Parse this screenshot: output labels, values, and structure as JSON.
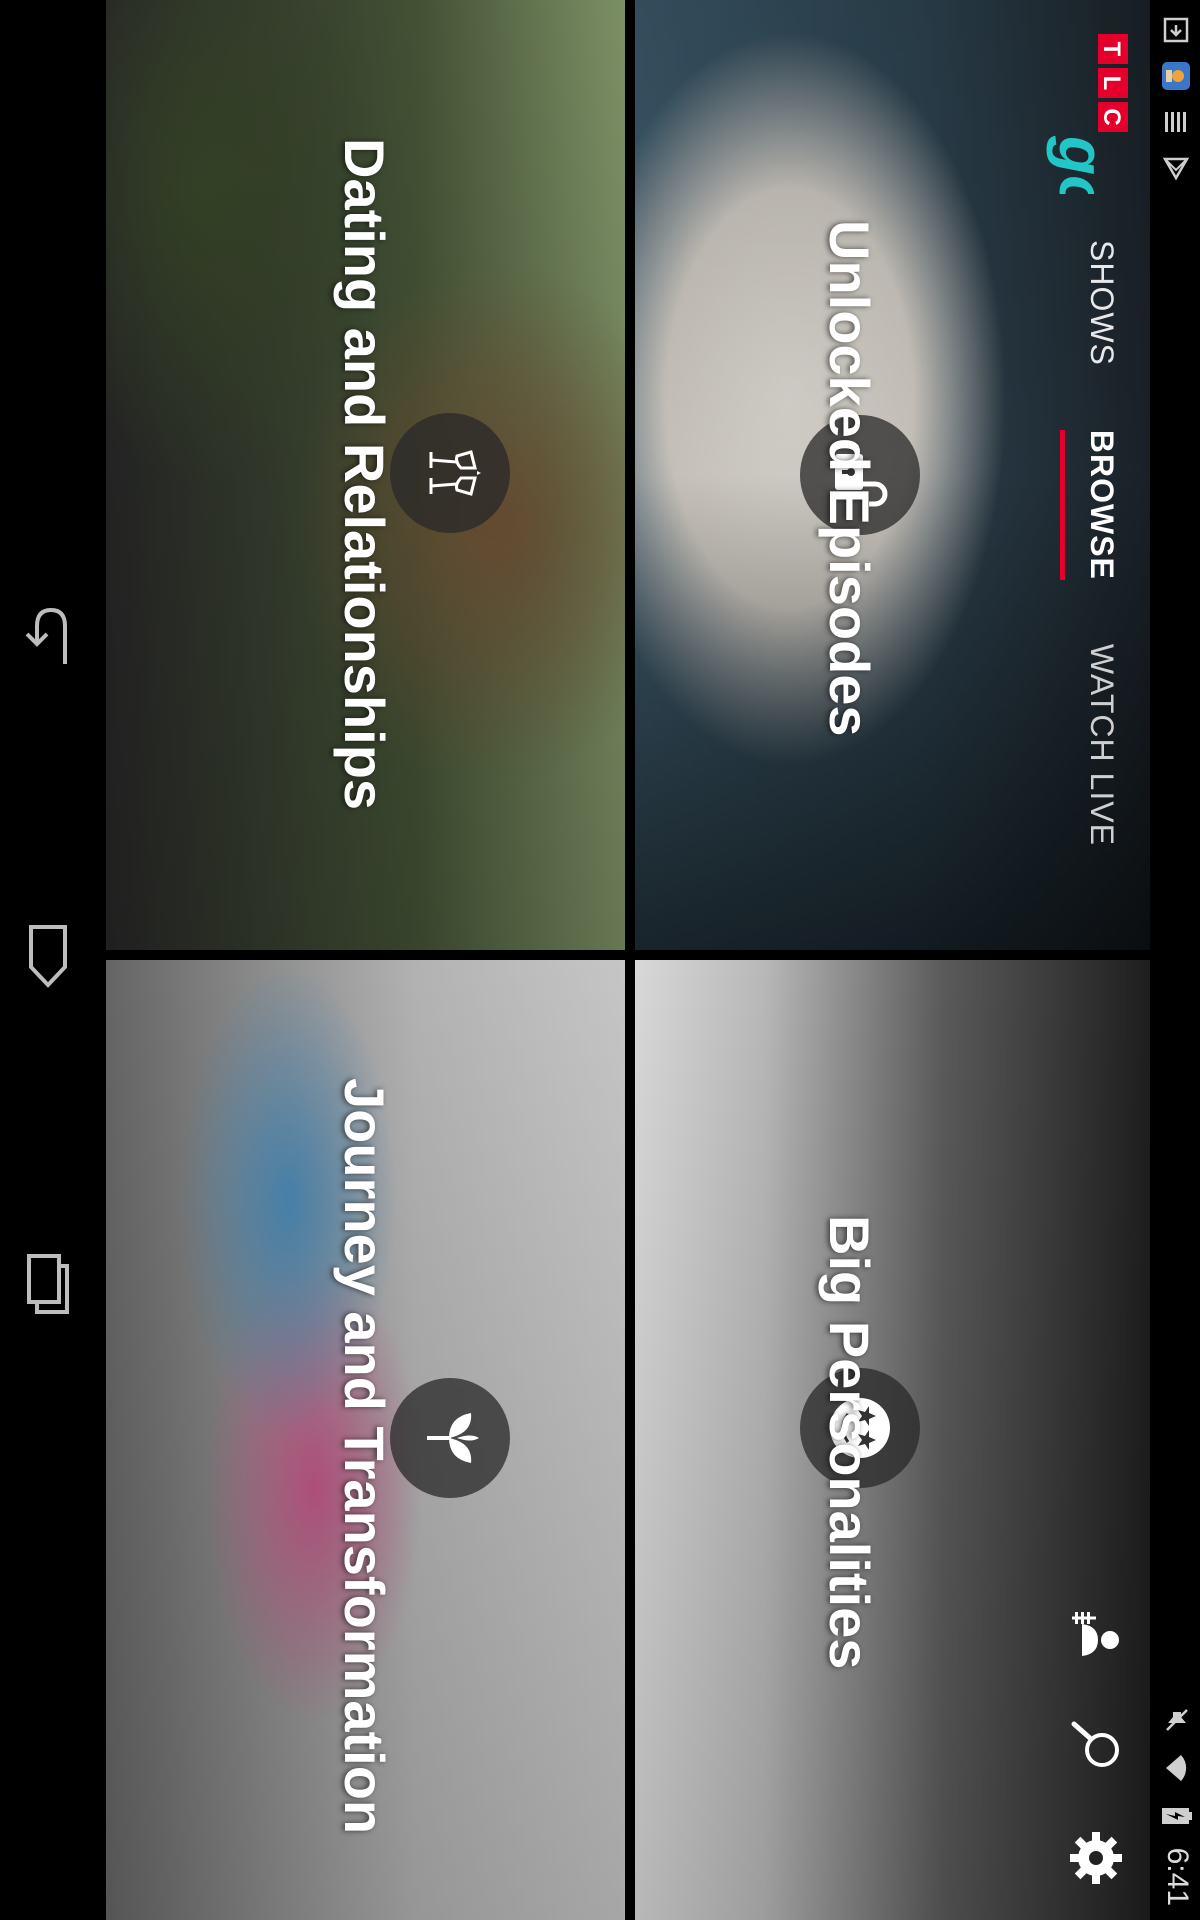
{
  "status_bar": {
    "time": "6:41",
    "left_icons": [
      "screenshot-icon",
      "app-notification-icon",
      "storage-icon",
      "play-store-icon"
    ],
    "right_icons": [
      "mute-icon",
      "wifi-icon",
      "battery-charging-icon"
    ]
  },
  "header": {
    "logo_text": "TLC",
    "logo_go": "go",
    "tabs": [
      {
        "label": "SHOWS",
        "active": false
      },
      {
        "label": "BROWSE",
        "active": true
      },
      {
        "label": "WATCH LIVE",
        "active": false
      }
    ],
    "actions": [
      "cast-profile-icon",
      "search-icon",
      "settings-icon"
    ]
  },
  "tiles": [
    {
      "title": "Unlocked Episodes",
      "icon": "unlock-icon"
    },
    {
      "title": "Big Personalities",
      "icon": "star-eyes-face-icon"
    },
    {
      "title": "Dating and Relationships",
      "icon": "toast-glasses-icon"
    },
    {
      "title": "Journey and Transformation",
      "icon": "sprout-icon"
    }
  ],
  "nav_bar": {
    "buttons": [
      "back-button",
      "home-button",
      "recents-button"
    ]
  },
  "colors": {
    "accent": "#e4002b",
    "logo_go": "#22c6c6"
  }
}
